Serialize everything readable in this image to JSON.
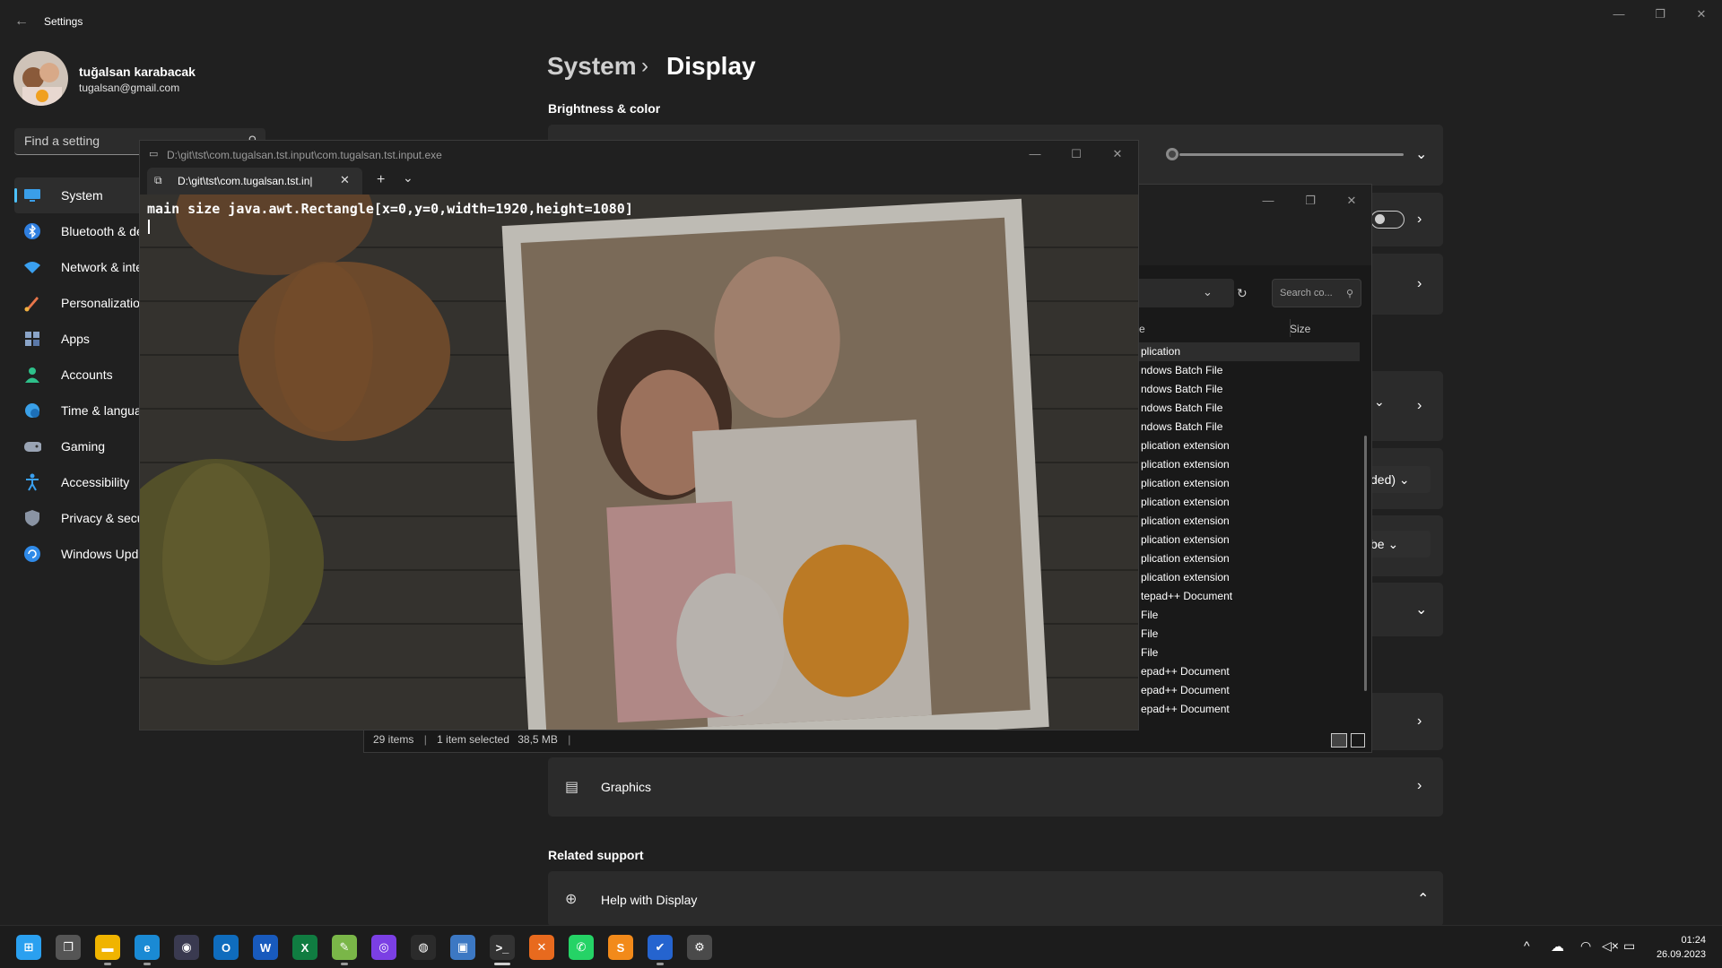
{
  "window": {
    "title": "Settings",
    "controls": [
      "minimize",
      "maximize",
      "close"
    ]
  },
  "profile": {
    "name": "tuğalsan karabacak",
    "email": "tugalsan@gmail.com"
  },
  "search": {
    "placeholder": "Find a setting"
  },
  "nav": {
    "items": [
      {
        "label": "System",
        "icon": "monitor-icon",
        "active": true
      },
      {
        "label": "Bluetooth & de",
        "icon": "bluetooth-icon"
      },
      {
        "label": "Network & inte",
        "icon": "wifi-icon"
      },
      {
        "label": "Personalization",
        "icon": "brush-icon"
      },
      {
        "label": "Apps",
        "icon": "apps-icon"
      },
      {
        "label": "Accounts",
        "icon": "person-icon"
      },
      {
        "label": "Time & languag",
        "icon": "globe-clock-icon"
      },
      {
        "label": "Gaming",
        "icon": "gamepad-icon"
      },
      {
        "label": "Accessibility",
        "icon": "accessibility-icon"
      },
      {
        "label": "Privacy & secur",
        "icon": "shield-icon"
      },
      {
        "label": "Windows Upda",
        "icon": "update-icon"
      }
    ]
  },
  "main": {
    "breadcrumb_parent": "System",
    "breadcrumb_separator": "›",
    "breadcrumb_current": "Display",
    "section_brightness": "Brightness & color",
    "brightness_level": 0.0,
    "graphics_label": "Graphics",
    "related_support": "Related support",
    "help_label": "Help with Display",
    "partial_select_1": "ded)",
    "partial_select_2": "be"
  },
  "terminal": {
    "title": "D:\\git\\tst\\com.tugalsan.tst.input\\com.tugalsan.tst.input.exe",
    "tab_label": "D:\\git\\tst\\com.tugalsan.tst.in|",
    "new_tab": "+",
    "dropdown": "⌄",
    "output": "main size java.awt.Rectangle[x=0,y=0,width=1920,height=1080]"
  },
  "explorer": {
    "search_placeholder": "Search co...",
    "col_type": "e",
    "col_size": "Size",
    "rows": [
      "plication",
      "ndows Batch File",
      "ndows Batch File",
      "ndows Batch File",
      "ndows Batch File",
      "plication extension",
      "plication extension",
      "plication extension",
      "plication extension",
      "plication extension",
      "plication extension",
      "plication extension",
      "plication extension",
      "tepad++ Document",
      "File",
      "File",
      "File",
      "epad++ Document",
      "epad++ Document",
      "epad++ Document"
    ],
    "status_items": "29 items",
    "status_selected": "1 item selected",
    "status_size": "38,5 MB"
  },
  "taskbar": {
    "apps": [
      {
        "name": "start-icon",
        "color": "#2aa0f0",
        "glyph": "⊞"
      },
      {
        "name": "task-view-icon",
        "color": "#555555",
        "glyph": "❐"
      },
      {
        "name": "file-explorer-icon",
        "color": "#f0b400",
        "glyph": "▬"
      },
      {
        "name": "edge-icon",
        "color": "#1a8ad4",
        "glyph": "e"
      },
      {
        "name": "camera-icon",
        "color": "#3a3a50",
        "glyph": "◉"
      },
      {
        "name": "outlook-icon",
        "color": "#0f6cbd",
        "glyph": "O"
      },
      {
        "name": "word-icon",
        "color": "#185abd",
        "glyph": "W"
      },
      {
        "name": "excel-icon",
        "color": "#107c41",
        "glyph": "X"
      },
      {
        "name": "notepad-plus-icon",
        "color": "#7ab648",
        "glyph": "✎"
      },
      {
        "name": "copilot-icon",
        "color": "#7b3fe4",
        "glyph": "◎"
      },
      {
        "name": "github-icon",
        "color": "#2b2b2b",
        "glyph": "◍"
      },
      {
        "name": "virtualbox-icon",
        "color": "#3c78c3",
        "glyph": "▣"
      },
      {
        "name": "terminal-icon",
        "color": "#333333",
        "glyph": ">_"
      },
      {
        "name": "xampp-icon",
        "color": "#e86a1e",
        "glyph": "✕"
      },
      {
        "name": "whatsapp-icon",
        "color": "#25d366",
        "glyph": "✆"
      },
      {
        "name": "sublime-icon",
        "color": "#f28a1a",
        "glyph": "S"
      },
      {
        "name": "todo-icon",
        "color": "#2564cf",
        "glyph": "✔"
      },
      {
        "name": "settings-icon",
        "color": "#4a4a4a",
        "glyph": "⚙"
      }
    ],
    "tray": {
      "chevron": "^",
      "time": "01:24",
      "date": "26.09.2023"
    }
  }
}
